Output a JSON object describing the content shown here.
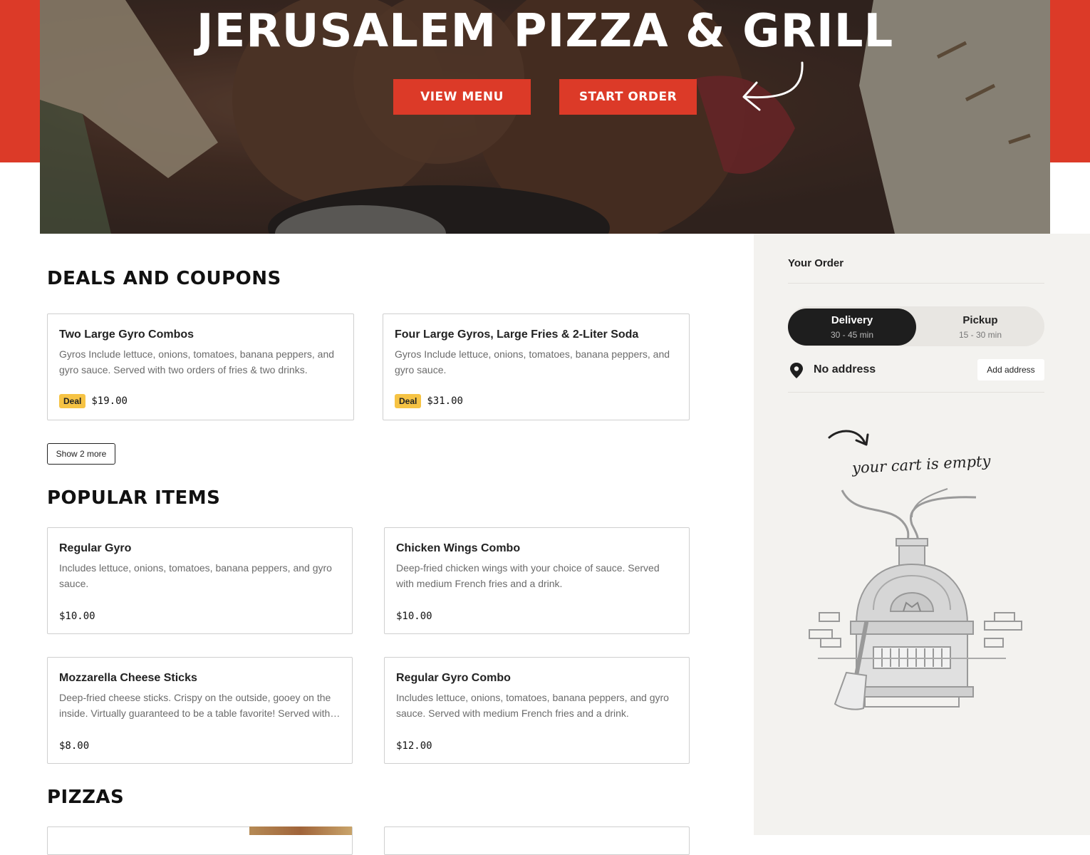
{
  "hero": {
    "title": "JERUSALEM PIZZA & GRILL",
    "view_menu_label": "VIEW MENU",
    "start_order_label": "START ORDER"
  },
  "deals": {
    "title": "DEALS AND COUPONS",
    "show_more_label": "Show 2 more",
    "items": [
      {
        "name": "Two Large Gyro Combos",
        "description": "Gyros Include lettuce, onions, tomatoes, banana peppers, and gyro sauce. Served with two orders of fries & two drinks.",
        "badge": "Deal",
        "price": "$19.00"
      },
      {
        "name": "Four Large Gyros, Large Fries & 2-Liter Soda",
        "description": "Gyros Include lettuce, onions, tomatoes, banana peppers, and gyro sauce.",
        "badge": "Deal",
        "price": "$31.00"
      }
    ]
  },
  "popular": {
    "title": "POPULAR ITEMS",
    "items": [
      {
        "name": "Regular Gyro",
        "description": "Includes lettuce, onions, tomatoes, banana peppers, and gyro sauce.",
        "price": "$10.00"
      },
      {
        "name": "Chicken Wings Combo",
        "description": "Deep-fried chicken wings with your choice of sauce. Served with medium French fries and a drink.",
        "price": "$10.00"
      },
      {
        "name": "Mozzarella Cheese Sticks",
        "description": "Deep-fried cheese sticks. Crispy on the outside, gooey on the inside. Virtually guaranteed to be a table favorite! Served with marinara sauce.",
        "price": "$8.00"
      },
      {
        "name": "Regular Gyro Combo",
        "description": "Includes lettuce, onions, tomatoes, banana peppers, and gyro sauce. Served with medium French fries and a drink.",
        "price": "$12.00"
      }
    ]
  },
  "pizzas": {
    "title": "PIZZAS"
  },
  "order": {
    "title": "Your Order",
    "delivery_label": "Delivery",
    "delivery_time": "30 - 45 min",
    "pickup_label": "Pickup",
    "pickup_time": "15 - 30 min",
    "address_text": "No address",
    "add_address_label": "Add address",
    "empty_cart_text": "your cart is empty"
  },
  "colors": {
    "brand_red": "#dc3a28",
    "deal_badge": "#f6c344",
    "sidebar_bg": "#f3f2ef"
  },
  "icons": [
    "arrow-curve-icon",
    "location-pin-icon",
    "pizza-oven-illustration"
  ]
}
